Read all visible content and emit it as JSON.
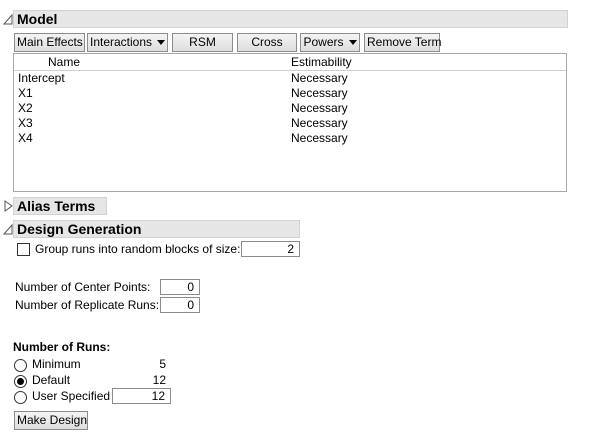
{
  "model": {
    "title": "Model",
    "buttons": {
      "main_effects": "Main Effects",
      "interactions": "Interactions",
      "rsm": "RSM",
      "cross": "Cross",
      "powers": "Powers",
      "remove_term": "Remove Term"
    },
    "table": {
      "columns": [
        "Name",
        "Estimability"
      ],
      "rows": [
        {
          "name": "Intercept",
          "estimability": "Necessary"
        },
        {
          "name": "X1",
          "estimability": "Necessary"
        },
        {
          "name": "X2",
          "estimability": "Necessary"
        },
        {
          "name": "X3",
          "estimability": "Necessary"
        },
        {
          "name": "X4",
          "estimability": "Necessary"
        }
      ]
    }
  },
  "alias_terms": {
    "title": "Alias Terms",
    "expanded": false
  },
  "design_generation": {
    "title": "Design Generation",
    "group_runs_label": "Group runs into random blocks of size:",
    "group_runs_checked": false,
    "block_size": "2",
    "center_points_label": "Number of Center Points:",
    "center_points": "0",
    "replicate_runs_label": "Number of Replicate Runs:",
    "replicate_runs": "0",
    "runs_heading": "Number of Runs:",
    "runs_options": [
      {
        "label": "Minimum",
        "value": "5",
        "selected": false
      },
      {
        "label": "Default",
        "value": "12",
        "selected": true
      },
      {
        "label": "User Specified",
        "value": "12",
        "selected": false
      }
    ],
    "make_design_label": "Make Design"
  },
  "icons": {
    "expanded": "triangle-down-icon",
    "collapsed": "triangle-right-icon"
  }
}
